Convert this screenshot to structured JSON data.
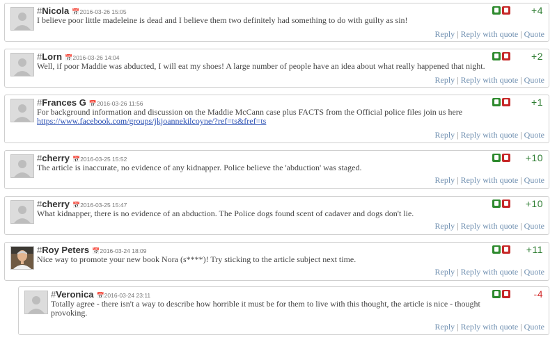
{
  "comments": [
    {
      "hash": "#",
      "author": "Nicola",
      "date": "2016-03-26 15:05",
      "text": "I believe poor little madeleine is dead and I believe them two definitely had something to do with guilty as sin!",
      "score": "+4",
      "has_photo": false
    },
    {
      "hash": "#",
      "author": "Lorn",
      "date": "2016-03-26 14:04",
      "text": "Well, if poor Maddie was abducted, I will eat my shoes! A large number of people have an idea about what really happened that night.",
      "score": "+2",
      "has_photo": false
    },
    {
      "hash": "#",
      "author": "Frances G",
      "date": "2016-03-26 11:56",
      "text": "For background information and discussion on the Maddie McCann case plus FACTS from the Official police files join us here",
      "link": "https://www.facebook.com/groups/jkjoannekilcoyne/?ref=ts&fref=ts",
      "score": "+1",
      "has_photo": false
    },
    {
      "hash": "#",
      "author": "cherry",
      "date": "2016-03-25 15:52",
      "text": "The article is inaccurate, no evidence of any kidnapper. Police believe the 'abduction' was staged.",
      "score": "+10",
      "has_photo": false
    },
    {
      "hash": "#",
      "author": "cherry",
      "date": "2016-03-25 15:47",
      "text": "What kidnapper, there is no evidence of an abduction. The Police dogs found scent of cadaver and dogs don't lie.",
      "score": "+10",
      "has_photo": false
    },
    {
      "hash": "#",
      "author": "Roy Peters",
      "date": "2016-03-24 18:09",
      "text": "Nice way to promote your new book Nora (s****)! Try sticking to the article subject next time.",
      "score": "+11",
      "has_photo": true
    },
    {
      "hash": "#",
      "author": "Veronica",
      "date": "2016-03-24 23:11",
      "text": "Totally agree - there isn't a way to describe how horrible it must be for them to live with this thought, the article is nice - thought provoking.",
      "score": "-4",
      "has_photo": false
    }
  ],
  "actions": {
    "reply": "Reply",
    "reply_with_quote": "Reply with quote",
    "quote": "Quote",
    "separator": "|"
  },
  "icons": {
    "calendar": "calendar-icon",
    "vote_up": "vote-up-icon",
    "vote_down": "vote-down-icon",
    "avatar_placeholder": "avatar-placeholder-icon"
  },
  "colors": {
    "positive_score": "#2e7d32",
    "negative_score": "#d32f2f",
    "link": "#2a4fb3",
    "action_link": "#6f8fb0"
  }
}
